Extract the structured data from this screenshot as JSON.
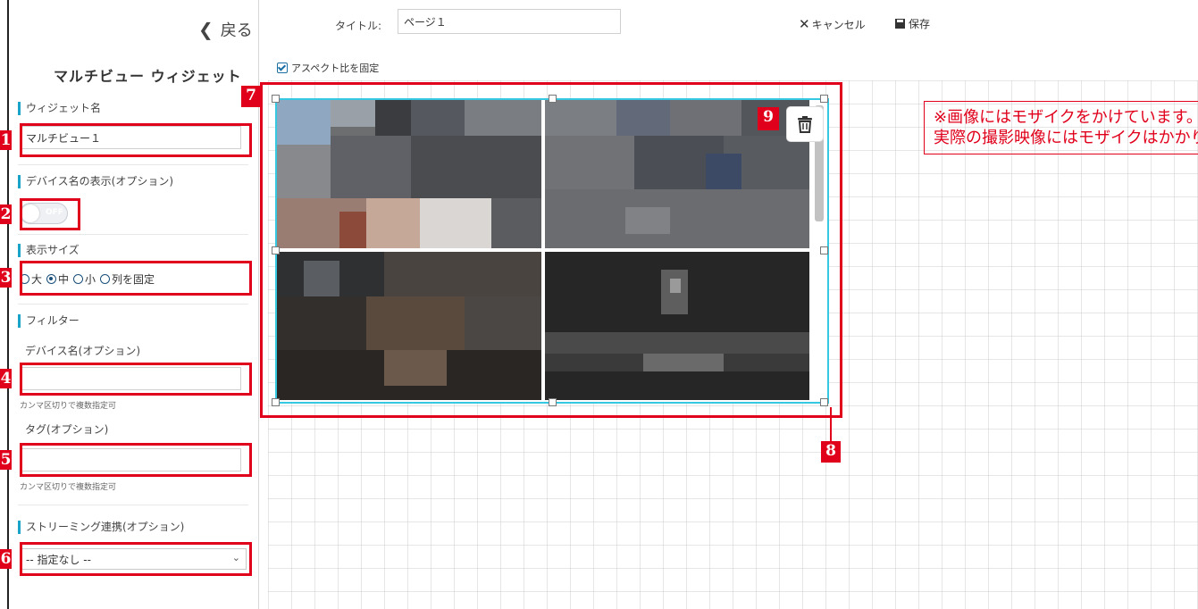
{
  "sidebar": {
    "back_label": "戻る",
    "panel_title": "マルチビュー ウィジェット",
    "widget_name": {
      "label": "ウィジェット名",
      "value": "マルチビュー１"
    },
    "device_name_display": {
      "label": "デバイス名の表示(オプション)",
      "toggle_state": "OFF"
    },
    "display_size": {
      "label": "表示サイズ",
      "options": [
        "大",
        "中",
        "小",
        "列を固定"
      ],
      "selected": "中"
    },
    "filter": {
      "label": "フィルター",
      "device_name_label": "デバイス名(オプション)",
      "device_name_value": "",
      "device_name_hint": "カンマ区切りで複数指定可",
      "tag_label": "タグ(オプション)",
      "tag_value": "",
      "tag_hint": "カンマ区切りで複数指定可"
    },
    "streaming": {
      "label": "ストリーミング連携(オプション)",
      "selected": "-- 指定なし --"
    }
  },
  "topbar": {
    "title_label": "タイトル:",
    "title_value": "ページ１",
    "cancel_label": "キャンセル",
    "save_label": "保存"
  },
  "canvas": {
    "aspect_lock_label": "アスペクト比を固定",
    "aspect_lock_checked": true
  },
  "annotations": {
    "badges": [
      "1",
      "2",
      "3",
      "4",
      "5",
      "6",
      "7",
      "8",
      "9"
    ],
    "note_line1": "※画像にはモザイクをかけています。",
    "note_line2": "実際の撮影映像にはモザイクはかかりません。"
  },
  "colors": {
    "accent": "#1aa3c8",
    "selection_border": "#35c8e0",
    "annotation_red": "#e0001b"
  },
  "icons": {
    "back": "chevron-left-icon",
    "cancel": "close-icon",
    "save": "floppy-disk-icon",
    "delete": "trash-icon",
    "select": "chevron-down-icon",
    "aspect": "checkbox-checked-icon"
  }
}
